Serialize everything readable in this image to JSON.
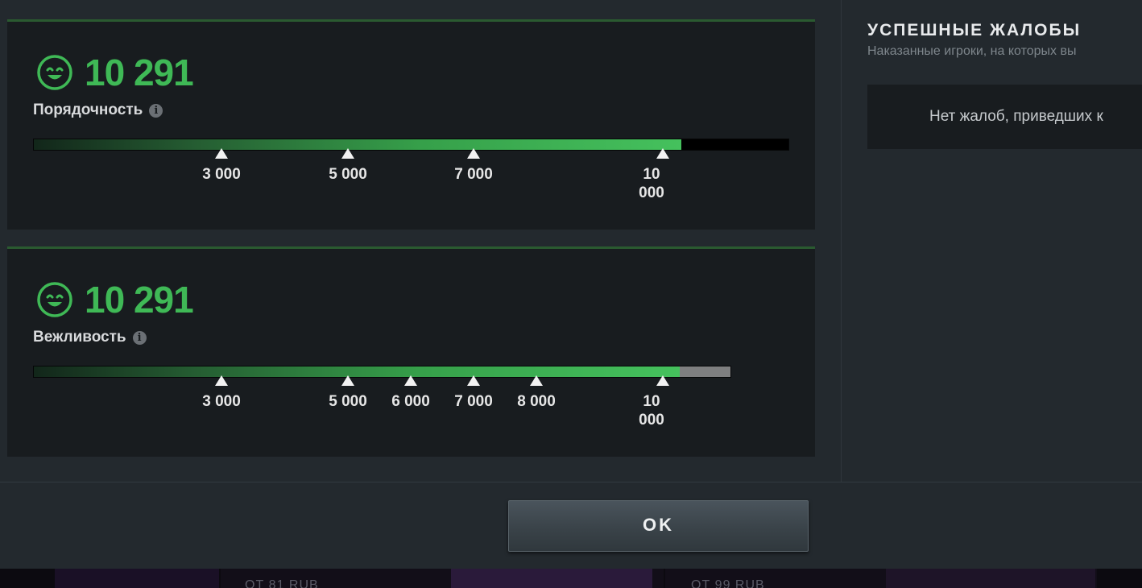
{
  "metrics": [
    {
      "score": "10 291",
      "label": "Порядочность",
      "progress": 0.858,
      "milestones": [
        "3 000",
        "5 000",
        "7 000",
        "10 000"
      ]
    },
    {
      "score": "10 291",
      "label": "Вежливость",
      "progress": 0.927,
      "milestones": [
        "3 000",
        "5 000",
        "6 000",
        "7 000",
        "8 000",
        "10 000"
      ]
    }
  ],
  "reports": {
    "title": "УСПЕШНЫЕ ЖАЛОБЫ",
    "subtitle": "Наказанные игроки, на которых вы",
    "empty_text": "Нет жалоб, приведших к"
  },
  "footer": {
    "ok_label": "OK"
  },
  "background_strip": {
    "price_left": "ОТ 81 RUB",
    "price_right": "ОТ 99 RUB"
  },
  "icons": {
    "score": "smiley-face-icon",
    "info": "info-icon"
  },
  "colors": {
    "score_green": "#3fb956",
    "panel_accent": "#2a5a30",
    "dialog_bg": "#23292e",
    "panel_bg": "#181c1f"
  }
}
